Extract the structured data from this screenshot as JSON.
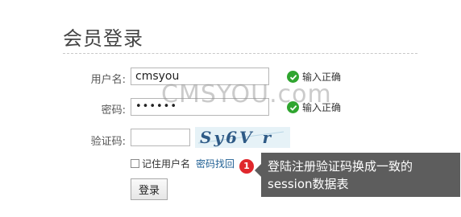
{
  "page": {
    "title": "会员登录"
  },
  "form": {
    "username_label": "用户名:",
    "username_value": "cmsyou",
    "username_status": "输入正确",
    "password_label": "密码:",
    "password_value": "••••••",
    "password_status": "输入正确",
    "captcha_label": "验证码:",
    "captcha_value": "",
    "captcha_image_text": "Sy6V r",
    "remember_label": "记住用户名",
    "recover_link": "密码找回",
    "login_button": "登录"
  },
  "watermark": "CMSYOU.com",
  "annotation": {
    "number": "1",
    "text": "登陆注册验证码换成一致的session数据表"
  },
  "colors": {
    "check": "#2fa52f",
    "link": "#1f5f93",
    "badge": "#e0272c",
    "note_bg": "#5d5d5d"
  }
}
